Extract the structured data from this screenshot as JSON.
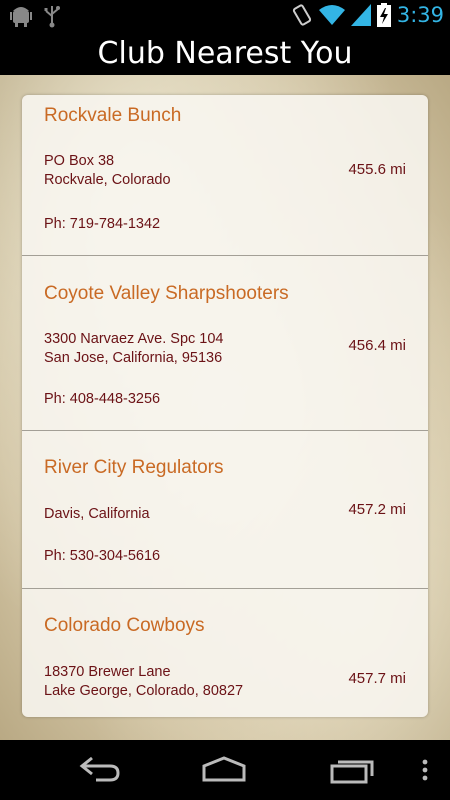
{
  "status_bar": {
    "time": "3:39",
    "icons": [
      "android-debug-icon",
      "usb-icon",
      "rotation-icon",
      "wifi-icon",
      "signal-icon",
      "battery-charging-icon"
    ],
    "accent_color": "#33b5e5"
  },
  "header": {
    "title": "Club Nearest You"
  },
  "clubs": [
    {
      "name": "Rockvale Bunch",
      "address_line1": "PO Box 38",
      "address_line2": "Rockvale, Colorado",
      "distance": "455.6 mi",
      "phone": "Ph: 719-784-1342"
    },
    {
      "name": "Coyote Valley Sharpshooters",
      "address_line1": "3300 Narvaez Ave. Spc 104",
      "address_line2": "San Jose, California, 95136",
      "distance": "456.4 mi",
      "phone": "Ph: 408-448-3256"
    },
    {
      "name": "River City Regulators",
      "address_line1": "Davis, California",
      "address_line2": "",
      "distance": "457.2 mi",
      "phone": "Ph: 530-304-5616"
    },
    {
      "name": "Colorado Cowboys",
      "address_line1": "18370 Brewer Lane",
      "address_line2": "Lake George, Colorado, 80827",
      "distance": "457.7 mi",
      "phone": ""
    }
  ],
  "colors": {
    "club_name": "#c96a24",
    "detail_text": "#6b1216"
  },
  "nav_bar": {
    "buttons": [
      "back-icon",
      "home-icon",
      "recent-apps-icon",
      "overflow-menu-icon"
    ]
  }
}
